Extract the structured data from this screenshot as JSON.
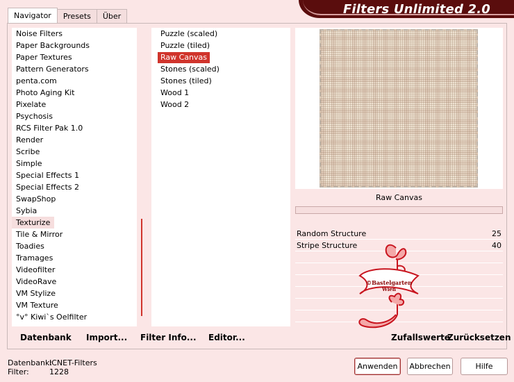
{
  "window": {
    "title": "Filters Unlimited 2.0"
  },
  "tabs": [
    {
      "label": "Navigator",
      "active": true
    },
    {
      "label": "Presets",
      "active": false
    },
    {
      "label": "Über",
      "active": false
    }
  ],
  "categories": [
    "Noise Filters",
    "Paper Backgrounds",
    "Paper Textures",
    "Pattern Generators",
    "penta.com",
    "Photo Aging Kit",
    "Pixelate",
    "Psychosis",
    "RCS Filter Pak 1.0",
    "Render",
    "Scribe",
    "Simple",
    "Special Effects 1",
    "Special Effects 2",
    "SwapShop",
    "Sybia",
    "Texturize",
    "Tile & Mirror",
    "Toadies",
    "Tramages",
    "Videofilter",
    "VideoRave",
    "VM Stylize",
    "VM Texture",
    "°v° Kiwi`s Oelfilter"
  ],
  "selected_category": "Texturize",
  "filters": [
    "Puzzle (scaled)",
    "Puzzle (tiled)",
    "Raw Canvas",
    "Stones (scaled)",
    "Stones (tiled)",
    "Wood 1",
    "Wood 2"
  ],
  "selected_filter": "Raw Canvas",
  "preview": {
    "filter_name": "Raw Canvas",
    "progress": 0
  },
  "parameters": [
    {
      "name": "Random Structure",
      "value": "25"
    },
    {
      "name": "Stripe Structure",
      "value": "40"
    }
  ],
  "watermark": {
    "line1": "©Bastelgarten",
    "line2": "Wien"
  },
  "left_actions": {
    "database": "Datenbank",
    "import": "Import...",
    "filter_info": "Filter Info...",
    "editor": "Editor..."
  },
  "right_actions": {
    "randomize": "Zufallswerte",
    "reset": "Zurücksetzen"
  },
  "status": {
    "database_label": "Datenbank:",
    "database_value": "ICNET-Filters",
    "filter_label": "Filter:",
    "filter_value": "1228"
  },
  "buttons": {
    "apply": "Anwenden",
    "cancel": "Abbrechen",
    "help": "Hilfe"
  },
  "colors": {
    "background": "#fbe6e6",
    "accent": "#d0342c",
    "title_bar": "#5a0d0d"
  }
}
